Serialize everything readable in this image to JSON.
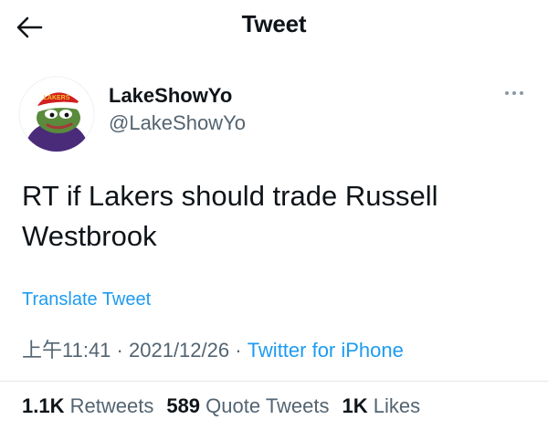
{
  "header": {
    "title": "Tweet",
    "back_icon": "arrow-left-icon"
  },
  "author": {
    "display_name": "LakeShowYo",
    "handle": "@LakeShowYo",
    "avatar_label": "LAKERS",
    "avatar_icon": "frog-santa-avatar"
  },
  "tweet": {
    "text": "RT if Lakers should trade Russell Westbrook",
    "translate_label": "Translate Tweet",
    "time": "上午11:41",
    "date": "2021/12/26",
    "separator": "·",
    "source": "Twitter for iPhone"
  },
  "stats": {
    "retweets_count": "1.1K",
    "retweets_label": "Retweets",
    "quotes_count": "589",
    "quotes_label": "Quote Tweets",
    "likes_count": "1K",
    "likes_label": "Likes"
  },
  "colors": {
    "link": "#1d9bf0",
    "secondary": "#536471",
    "primary": "#0f1419",
    "divider": "#e1e6ea"
  }
}
